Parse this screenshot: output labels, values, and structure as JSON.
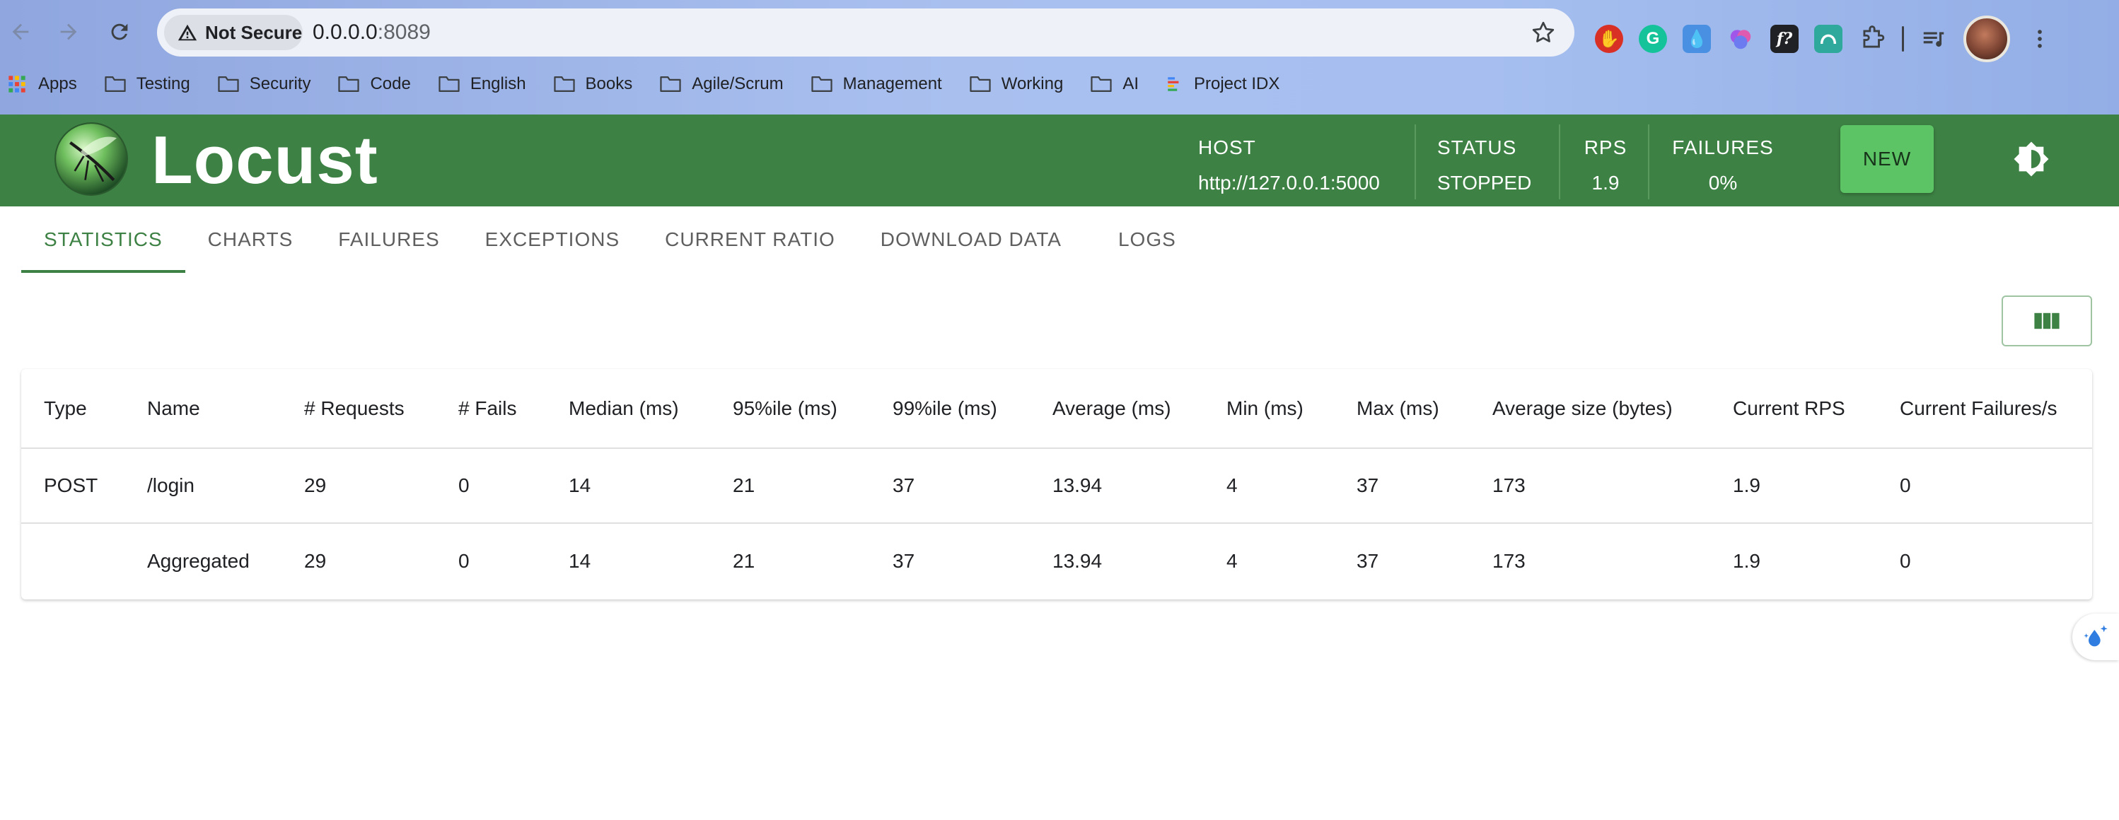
{
  "browser": {
    "security_label": "Not Secure",
    "url_host": "0.0.0.0",
    "url_port": ":8089",
    "bookmarks": [
      {
        "label": "Apps",
        "icon": "apps-grid-icon"
      },
      {
        "label": "Testing",
        "icon": "folder-icon"
      },
      {
        "label": "Security",
        "icon": "folder-icon"
      },
      {
        "label": "Code",
        "icon": "folder-icon"
      },
      {
        "label": "English",
        "icon": "folder-icon"
      },
      {
        "label": "Books",
        "icon": "folder-icon"
      },
      {
        "label": "Agile/Scrum",
        "icon": "folder-icon"
      },
      {
        "label": "Management",
        "icon": "folder-icon"
      },
      {
        "label": "Working",
        "icon": "folder-icon"
      },
      {
        "label": "AI",
        "icon": "folder-icon"
      },
      {
        "label": "Project IDX",
        "icon": "project-idx-icon"
      }
    ],
    "extension_f_label": "f?"
  },
  "header": {
    "brand": "Locust",
    "host_label": "HOST",
    "host_value": "http://127.0.0.1:5000",
    "status_label": "STATUS",
    "status_value": "STOPPED",
    "rps_label": "RPS",
    "rps_value": "1.9",
    "failures_label": "FAILURES",
    "failures_value": "0%",
    "new_button": "NEW",
    "colors": {
      "header_bg": "#3d8144",
      "new_button_bg": "#5cc465"
    }
  },
  "tabs": [
    {
      "label": "STATISTICS",
      "active": true
    },
    {
      "label": "CHARTS",
      "active": false
    },
    {
      "label": "FAILURES",
      "active": false
    },
    {
      "label": "EXCEPTIONS",
      "active": false
    },
    {
      "label": "CURRENT RATIO",
      "active": false
    },
    {
      "label": "DOWNLOAD DATA",
      "active": false
    },
    {
      "label": "LOGS",
      "active": false
    }
  ],
  "table": {
    "columns": [
      "Type",
      "Name",
      "# Requests",
      "# Fails",
      "Median (ms)",
      "95%ile (ms)",
      "99%ile (ms)",
      "Average (ms)",
      "Min (ms)",
      "Max (ms)",
      "Average size (bytes)",
      "Current RPS",
      "Current Failures/s"
    ],
    "rows": [
      [
        "POST",
        "/login",
        "29",
        "0",
        "14",
        "21",
        "37",
        "13.94",
        "4",
        "37",
        "173",
        "1.9",
        "0"
      ],
      [
        "",
        "Aggregated",
        "29",
        "0",
        "14",
        "21",
        "37",
        "13.94",
        "4",
        "37",
        "173",
        "1.9",
        "0"
      ]
    ]
  }
}
